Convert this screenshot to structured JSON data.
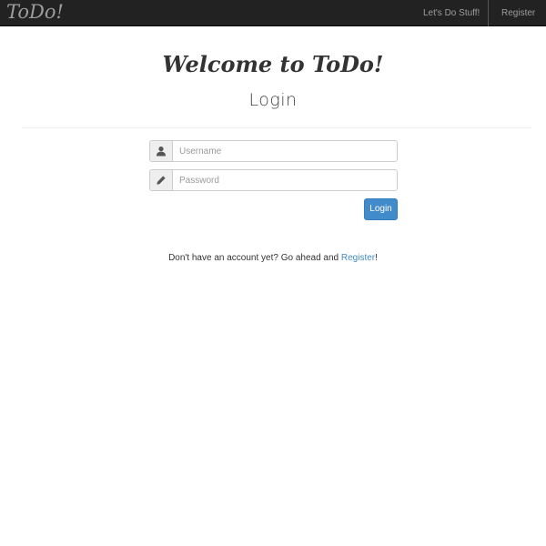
{
  "navbar": {
    "brand": "ToDo!",
    "links": {
      "lets_do_stuff": "Let's Do Stuff!",
      "register": "Register"
    }
  },
  "main": {
    "heading_prefix": "Welcome to ",
    "heading_brand": "ToDo!",
    "subheading": "Login"
  },
  "form": {
    "username": {
      "placeholder": "Username",
      "value": "",
      "icon": "user-icon"
    },
    "password": {
      "placeholder": "Password",
      "value": "",
      "icon": "pencil-icon"
    },
    "login_button": "Login"
  },
  "footer": {
    "prompt": "Don't have an account yet? Go ahead and ",
    "register_link": "Register",
    "suffix": "!"
  },
  "colors": {
    "navbar_bg": "#222222",
    "nav_text": "#9d9d9d",
    "primary": "#428bca",
    "addon_bg": "#eeeeee"
  }
}
